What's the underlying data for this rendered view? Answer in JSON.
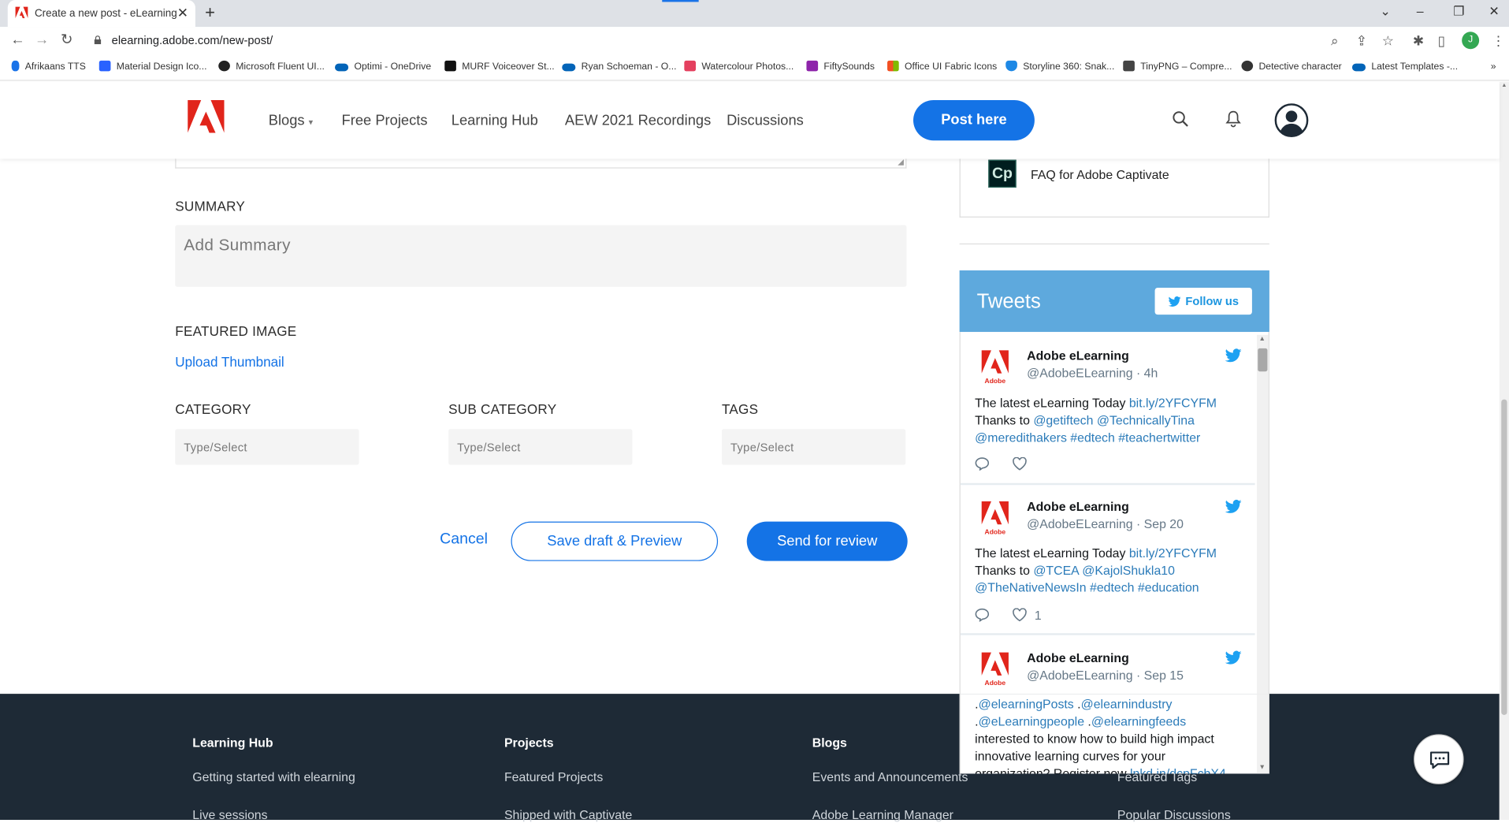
{
  "browser": {
    "tab_title": "Create a new post - eLearning",
    "url": "elearning.adobe.com/new-post/",
    "profile_initial": "J",
    "bookmarks": [
      "Afrikaans TTS",
      "Material Design Ico...",
      "Microsoft Fluent UI...",
      "Optimi - OneDrive",
      "MURF Voiceover St...",
      "Ryan Schoeman - O...",
      "Watercolour Photos...",
      "FiftySounds",
      "Office UI Fabric Icons",
      "Storyline 360: Snak...",
      "TinyPNG – Compre...",
      "Detective character",
      "Latest Templates -..."
    ]
  },
  "header": {
    "nav": [
      "Blogs",
      "Free Projects",
      "Learning Hub",
      "AEW 2021 Recordings",
      "Discussions"
    ],
    "post_button": "Post here"
  },
  "form": {
    "summary_label": "SUMMARY",
    "summary_placeholder": "Add Summary",
    "featured_label": "FEATURED IMAGE",
    "upload_link": "Upload Thumbnail",
    "category_label": "CATEGORY",
    "subcategory_label": "SUB CATEGORY",
    "tags_label": "TAGS",
    "select_placeholder": "Type/Select",
    "cancel": "Cancel",
    "save_draft": "Save draft & Preview",
    "send_review": "Send for review"
  },
  "sidebar": {
    "faq_icon": "Cp",
    "faq_text": "FAQ for Adobe Captivate",
    "tweets_title": "Tweets",
    "follow_label": "Follow us",
    "tweets": [
      {
        "name": "Adobe eLearning",
        "handle": "@AdobeELearning · 4h",
        "lines": [
          [
            [
              "The latest eLearning Today ",
              false
            ],
            [
              "bit.ly/2YFCYFM",
              true
            ]
          ],
          [
            [
              "Thanks to ",
              false
            ],
            [
              "@getiftech @TechnicallyTina",
              true
            ]
          ],
          [
            [
              "@meredithakers #edtech #teachertwitter",
              true
            ]
          ]
        ],
        "likes": ""
      },
      {
        "name": "Adobe eLearning",
        "handle": "@AdobeELearning · Sep 20",
        "lines": [
          [
            [
              "The latest eLearning Today ",
              false
            ],
            [
              "bit.ly/2YFCYFM",
              true
            ]
          ],
          [
            [
              "Thanks to ",
              false
            ],
            [
              "@TCEA @KajolShukla10",
              true
            ]
          ],
          [
            [
              "@TheNativeNewsIn #edtech #education",
              true
            ]
          ]
        ],
        "likes": "1"
      },
      {
        "name": "Adobe eLearning",
        "handle": "@AdobeELearning · Sep 15",
        "lines": [
          [
            [
              ".",
              false
            ],
            [
              "@elearningPosts",
              true
            ],
            [
              " .",
              false
            ],
            [
              "@elearnindustry",
              true
            ]
          ],
          [
            [
              ".",
              false
            ],
            [
              "@eLearningpeople",
              true
            ],
            [
              " .",
              false
            ],
            [
              "@elearningfeeds",
              true
            ]
          ],
          [
            [
              "interested to know how to build high impact",
              false
            ]
          ],
          [
            [
              "innovative learning curves for your",
              false
            ]
          ],
          [
            [
              "organization? Register now ",
              false
            ],
            [
              "lnkd.in/dcpFcbX4",
              true
            ]
          ]
        ],
        "likes": ""
      }
    ]
  },
  "footer": {
    "columns": [
      {
        "title": "Learning Hub",
        "items": [
          "Getting started with elearning",
          "Live sessions"
        ]
      },
      {
        "title": "Projects",
        "items": [
          "Featured Projects",
          "Shipped with Captivate"
        ]
      },
      {
        "title": "Blogs",
        "items": [
          "Events and Announcements",
          "Adobe Learning Manager"
        ]
      },
      {
        "title": "",
        "items": [
          "Featured Tags",
          "Popular Discussions"
        ]
      }
    ]
  },
  "colors": {
    "accent": "#1473e6",
    "adobe_red": "#e1251b",
    "twitter_blue": "#1da1f2",
    "tweets_header": "#5ea9dd",
    "footer_bg": "#1e2a36"
  },
  "icons": [
    "adobe-logo-icon",
    "search-icon",
    "bell-icon",
    "user-avatar-icon",
    "twitter-bird-icon",
    "reply-icon",
    "heart-icon",
    "chat-icon",
    "captivate-icon"
  ]
}
